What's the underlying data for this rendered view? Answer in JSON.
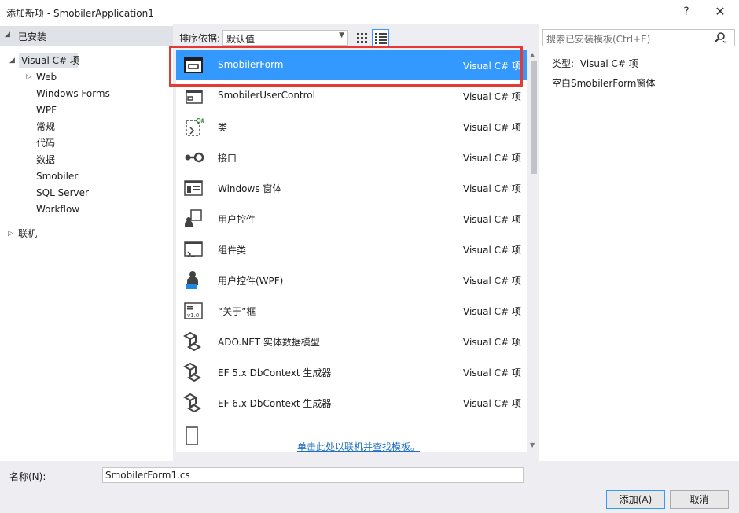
{
  "window": {
    "title": "添加新项 - SmobilerApplication1",
    "help_label": "?",
    "close_label": "✕"
  },
  "sidebar": {
    "installed_label": "已安装",
    "items": [
      {
        "label": "Visual C# 项",
        "selected": true
      },
      {
        "label": "Web"
      },
      {
        "label": "Windows Forms"
      },
      {
        "label": "WPF"
      },
      {
        "label": "常规"
      },
      {
        "label": "代码"
      },
      {
        "label": "数据"
      },
      {
        "label": "Smobiler"
      },
      {
        "label": "SQL Server"
      },
      {
        "label": "Workflow"
      },
      {
        "label": "联机"
      }
    ]
  },
  "sortbar": {
    "label": "排序依据:",
    "selected": "默认值"
  },
  "templates": [
    {
      "name": "SmobilerForm",
      "lang": "Visual C# 项",
      "icon": "form-window-icon",
      "selected": true
    },
    {
      "name": "SmobilerUserControl",
      "lang": "Visual C# 项",
      "icon": "user-control-icon"
    },
    {
      "name": "类",
      "lang": "Visual C# 项",
      "icon": "class-icon"
    },
    {
      "name": "接口",
      "lang": "Visual C# 项",
      "icon": "interface-icon"
    },
    {
      "name": "Windows 窗体",
      "lang": "Visual C# 项",
      "icon": "windows-form-icon"
    },
    {
      "name": "用户控件",
      "lang": "Visual C# 项",
      "icon": "user-control-icon"
    },
    {
      "name": "组件类",
      "lang": "Visual C# 项",
      "icon": "component-class-icon"
    },
    {
      "name": "用户控件(WPF)",
      "lang": "Visual C# 项",
      "icon": "wpf-user-control-icon"
    },
    {
      "name": "“关于”框",
      "lang": "Visual C# 项",
      "icon": "about-box-icon"
    },
    {
      "name": "ADO.NET 实体数据模型",
      "lang": "Visual C# 项",
      "icon": "data-model-icon"
    },
    {
      "name": "EF 5.x DbContext 生成器",
      "lang": "Visual C# 项",
      "icon": "data-model-icon"
    },
    {
      "name": "EF 6.x DbContext 生成器",
      "lang": "Visual C# 项",
      "icon": "data-model-icon"
    }
  ],
  "online_link": "单击此处以联机并查找模板。",
  "search": {
    "placeholder": "搜索已安装模板(Ctrl+E)"
  },
  "details": {
    "type_label": "类型:",
    "type_value": "Visual C# 项",
    "description": "空白SmobilerForm窗体"
  },
  "footer": {
    "name_label": "名称(N):",
    "name_value": "SmobilerForm1.cs",
    "add_label": "添加(A)",
    "cancel_label": "取消"
  },
  "colors": {
    "selection": "#3399ff",
    "highlight_box": "#e53935",
    "link": "#1e6fc1"
  }
}
